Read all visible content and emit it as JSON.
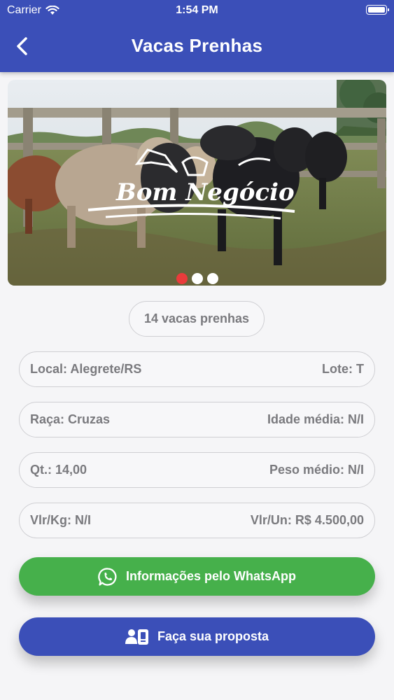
{
  "status_bar": {
    "carrier": "Carrier",
    "time": "1:54 PM"
  },
  "header": {
    "title": "Vacas Prenhas"
  },
  "carousel": {
    "brand": "Bom Negócio",
    "total_slides": 3,
    "active_slide": 1
  },
  "listing": {
    "count_label": "14 vacas prenhas",
    "rows": [
      {
        "left": "Local: Alegrete/RS",
        "right": "Lote: T"
      },
      {
        "left": "Raça: Cruzas",
        "right": "Idade média: N/I"
      },
      {
        "left": "Qt.: 14,00",
        "right": "Peso médio: N/I"
      },
      {
        "left": "Vlr/Kg: N/I",
        "right": "Vlr/Un: R$ 4.500,00"
      }
    ]
  },
  "actions": {
    "whatsapp_label": "Informações pelo WhatsApp",
    "proposta_label": "Faça sua proposta"
  },
  "colors": {
    "header": "#3b4fb8",
    "whatsapp": "#46b04b",
    "dot_active": "#ea3b3b"
  }
}
